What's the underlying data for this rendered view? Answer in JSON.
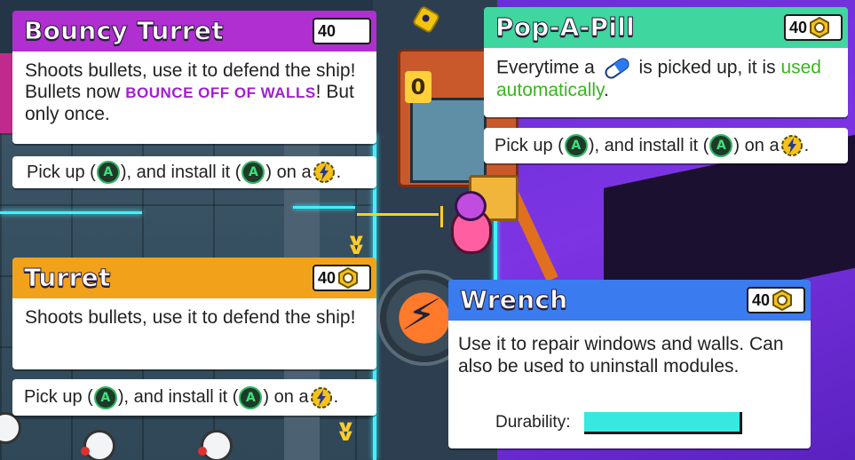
{
  "colors": {
    "bouncy_header": "#b02fd0",
    "popapill_header": "#3fd6a0",
    "turret_header": "#f2a21a",
    "wrench_header": "#3a7cf0",
    "purple_highlight": "#a020d0",
    "green_highlight": "#38b61f",
    "durability_fill": "#36e8e0"
  },
  "cards": {
    "bouncy_turret": {
      "title": "Bouncy Turret",
      "cost": "40",
      "desc_part1": "Shoots bullets, use it to defend the ship! Bullets now ",
      "desc_highlight": "BOUNCE OFF OF WALLS",
      "desc_part2": "! But only once.",
      "pickup": {
        "text1": "Pick up (",
        "text2": "), and install it (",
        "text3": ") on a ",
        "text4": ".",
        "button_glyph": "A"
      }
    },
    "pop_a_pill": {
      "title": "Pop-A-Pill",
      "cost": "40",
      "desc_part1": "Everytime a ",
      "desc_part2": " is picked up, it is ",
      "desc_highlight": "used automatically",
      "desc_part3": ".",
      "pickup": {
        "text1": "Pick up (",
        "text2": "), and install it (",
        "text3": ") on a ",
        "text4": ".",
        "button_glyph": "A"
      }
    },
    "turret": {
      "title": "Turret",
      "cost": "40",
      "desc": "Shoots bullets, use it to defend the ship!",
      "pickup": {
        "text1": "Pick up (",
        "text2": "), and install it (",
        "text3": ") on a ",
        "text4": ".",
        "button_glyph": "A"
      }
    },
    "wrench": {
      "title": "Wrench",
      "cost": "40",
      "desc": "Use it to repair windows and walls. Can also be used to uninstall modules.",
      "durability_label": "Durability:",
      "durability_level": 1.0
    }
  },
  "scene": {
    "counter_digit": "0"
  },
  "icons": {
    "currency": "hex-nut-icon",
    "button": "a-button-icon",
    "slot": "lightning-slot-icon",
    "pill": "pill-icon"
  }
}
